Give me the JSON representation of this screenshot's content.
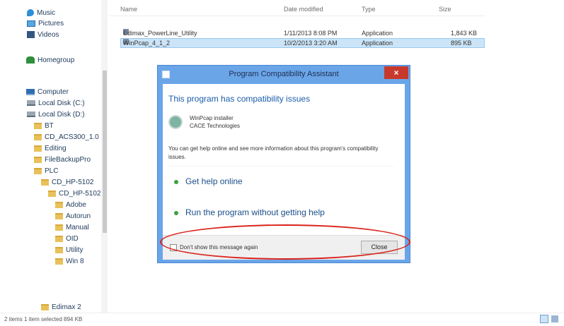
{
  "nav": {
    "items": [
      {
        "label": "Music",
        "icon": "music-icon"
      },
      {
        "label": "Pictures",
        "icon": "pictures-icon"
      },
      {
        "label": "Videos",
        "icon": "videos-icon"
      },
      {
        "label": "Homegroup",
        "icon": "homegroup-icon"
      },
      {
        "label": "Computer",
        "icon": "computer-icon"
      },
      {
        "label": "Local Disk (C:)",
        "icon": "drive-icon"
      },
      {
        "label": "Local Disk (D:)",
        "icon": "drive-icon"
      },
      {
        "label": "BT",
        "icon": "folder-icon"
      },
      {
        "label": "CD_ACS300_1.0",
        "icon": "folder-icon"
      },
      {
        "label": "Editing",
        "icon": "folder-icon"
      },
      {
        "label": "FileBackupPro",
        "icon": "folder-icon"
      },
      {
        "label": "PLC",
        "icon": "folder-icon"
      },
      {
        "label": "CD_HP-5102",
        "icon": "folder-icon"
      },
      {
        "label": "CD_HP-5102",
        "icon": "folder-icon"
      },
      {
        "label": "Adobe",
        "icon": "folder-icon"
      },
      {
        "label": "Autorun",
        "icon": "folder-icon"
      },
      {
        "label": "Manual",
        "icon": "folder-icon"
      },
      {
        "label": "OID",
        "icon": "folder-icon"
      },
      {
        "label": "Utility",
        "icon": "folder-icon"
      },
      {
        "label": "Win 8",
        "icon": "folder-icon"
      },
      {
        "label": "Edimax 2",
        "icon": "folder-icon"
      }
    ]
  },
  "columns": {
    "name": "Name",
    "date": "Date modified",
    "type": "Type",
    "size": "Size"
  },
  "files": [
    {
      "name": "Edimax_PowerLine_Utility",
      "date": "1/11/2013 8:08 PM",
      "type": "Application",
      "size": "1,843 KB"
    },
    {
      "name": "WinPcap_4_1_2",
      "date": "10/2/2013 3:20 AM",
      "type": "Application",
      "size": "895 KB"
    }
  ],
  "status": {
    "text": "2 items    1 item selected  894 KB"
  },
  "dialog": {
    "title": "Program Compatibility Assistant",
    "heading": "This program has compatibility issues",
    "program_name": "WinPcap installer",
    "publisher": "CACE Technologies",
    "description": "You can get help online and see more information about this program's compatibility issues.",
    "option1": "Get help online",
    "option2": "Run the program without getting help",
    "dont_show": "Don't show this message again",
    "close": "Close",
    "close_glyph": "×"
  },
  "colors": {
    "annotation": "#d9221a",
    "dialog_frame": "#6aa5e8",
    "close_button": "#c7392d",
    "heading": "#1b5dab"
  }
}
